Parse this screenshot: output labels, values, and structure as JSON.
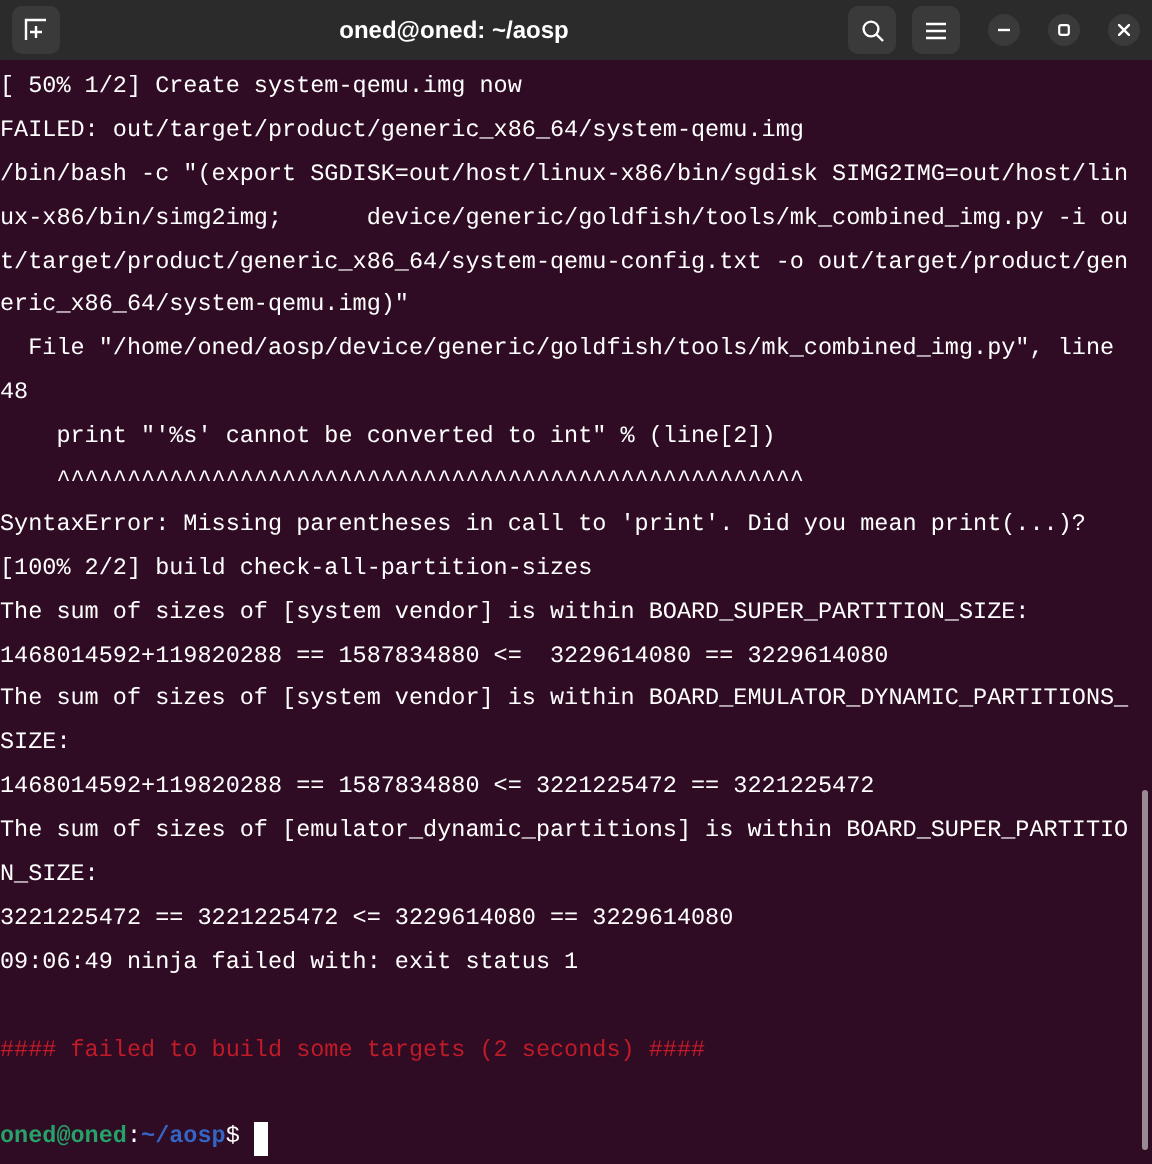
{
  "window": {
    "title": "oned@oned: ~/aosp"
  },
  "lines": [
    {
      "kind": "normal",
      "text": "[ 50% 1/2] Create system-qemu.img now"
    },
    {
      "kind": "normal",
      "text": "FAILED: out/target/product/generic_x86_64/system-qemu.img"
    },
    {
      "kind": "normal",
      "text": "/bin/bash -c \"(export SGDISK=out/host/linux-x86/bin/sgdisk SIMG2IMG=out/host/lin"
    },
    {
      "kind": "normal",
      "text": "ux-x86/bin/simg2img;      device/generic/goldfish/tools/mk_combined_img.py -i ou"
    },
    {
      "kind": "normal",
      "text": "t/target/product/generic_x86_64/system-qemu-config.txt -o out/target/product/gen"
    },
    {
      "kind": "normal",
      "text": "eric_x86_64/system-qemu.img)\""
    },
    {
      "kind": "normal",
      "text": "  File \"/home/oned/aosp/device/generic/goldfish/tools/mk_combined_img.py\", line"
    },
    {
      "kind": "normal",
      "text": "48"
    },
    {
      "kind": "normal",
      "text": "    print \"'%s' cannot be converted to int\" % (line[2])"
    },
    {
      "kind": "normal",
      "text": "    ^^^^^^^^^^^^^^^^^^^^^^^^^^^^^^^^^^^^^^^^^^^^^^^^^^^^^"
    },
    {
      "kind": "normal",
      "text": "SyntaxError: Missing parentheses in call to 'print'. Did you mean print(...)?"
    },
    {
      "kind": "normal",
      "text": "[100% 2/2] build check-all-partition-sizes"
    },
    {
      "kind": "normal",
      "text": "The sum of sizes of [system vendor] is within BOARD_SUPER_PARTITION_SIZE:"
    },
    {
      "kind": "normal",
      "text": "1468014592+119820288 == 1587834880 <=  3229614080 == 3229614080"
    },
    {
      "kind": "normal",
      "text": "The sum of sizes of [system vendor] is within BOARD_EMULATOR_DYNAMIC_PARTITIONS_"
    },
    {
      "kind": "normal",
      "text": "SIZE:"
    },
    {
      "kind": "normal",
      "text": "1468014592+119820288 == 1587834880 <= 3221225472 == 3221225472"
    },
    {
      "kind": "normal",
      "text": "The sum of sizes of [emulator_dynamic_partitions] is within BOARD_SUPER_PARTITIO"
    },
    {
      "kind": "normal",
      "text": "N_SIZE:"
    },
    {
      "kind": "normal",
      "text": "3221225472 == 3221225472 <= 3229614080 == 3229614080"
    },
    {
      "kind": "normal",
      "text": "09:06:49 ninja failed with: exit status 1"
    },
    {
      "kind": "blank"
    },
    {
      "kind": "error",
      "text": "#### failed to build some targets (2 seconds) ####"
    },
    {
      "kind": "blank"
    }
  ],
  "prompt": {
    "user": "oned@oned",
    "separator": ":",
    "path": "~/aosp",
    "symbol": "$"
  }
}
